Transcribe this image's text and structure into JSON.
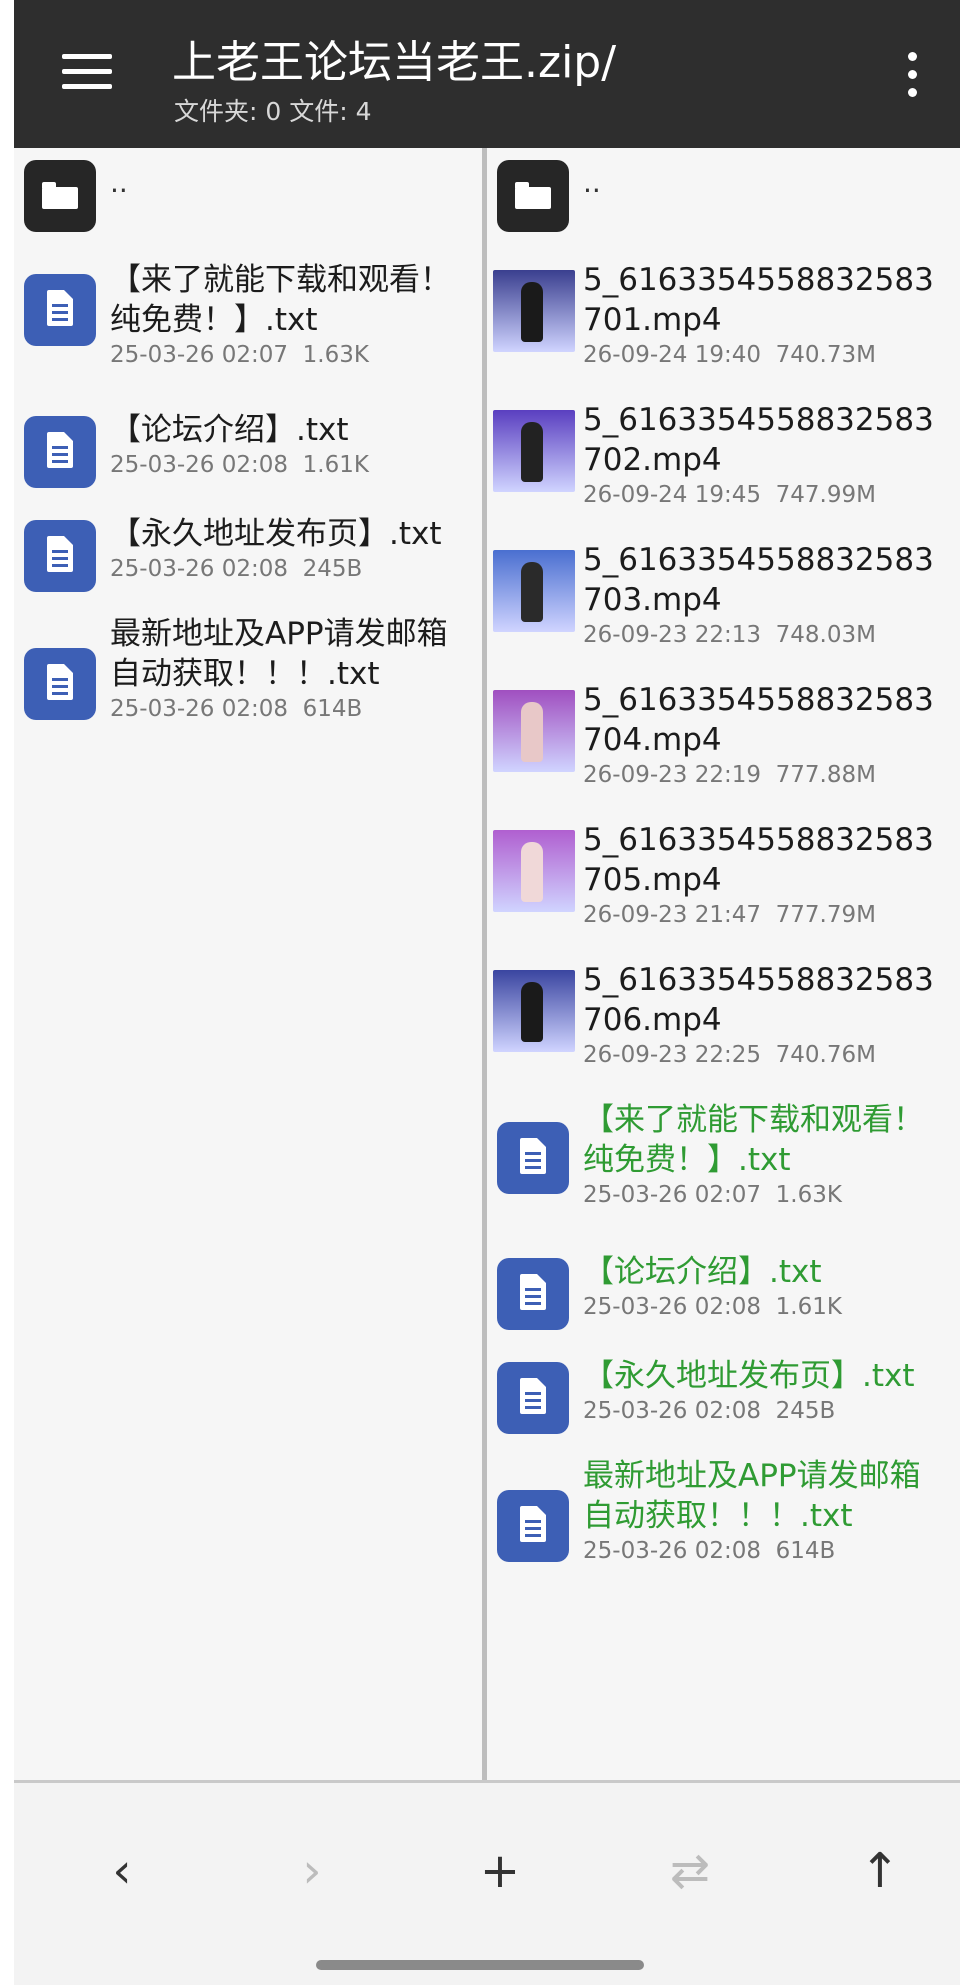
{
  "header": {
    "title": "上老王论坛当老王.zip/",
    "subtitle": "文件夹: 0  文件: 4"
  },
  "left_pane": {
    "parent_label": "..",
    "files": [
      {
        "name_line1": "【来了就能下载和观看！",
        "name_line2": "纯免费！】.txt",
        "date": "25-03-26 02:07",
        "size": "1.63K",
        "icon": "document-icon"
      },
      {
        "name_line1": "【论坛介绍】.txt",
        "name_line2": "",
        "date": "25-03-26 02:08",
        "size": "1.61K",
        "icon": "document-icon"
      },
      {
        "name_line1": "【永久地址发布页】.txt",
        "name_line2": "",
        "date": "25-03-26 02:08",
        "size": "245B",
        "icon": "document-icon"
      },
      {
        "name_line1": "最新地址及APP请发邮箱",
        "name_line2": "自动获取！！！.txt",
        "date": "25-03-26 02:08",
        "size": "614B",
        "icon": "document-icon"
      }
    ]
  },
  "right_pane": {
    "parent_label": "..",
    "videos": [
      {
        "name_line1": "5_6163354558832583",
        "name_line2": "701.mp4",
        "date": "26-09-24 19:40",
        "size": "740.73M",
        "thumb_bg": "#3a3f8f",
        "thumb_fig": "#1a1a1a"
      },
      {
        "name_line1": "5_6163354558832583",
        "name_line2": "702.mp4",
        "date": "26-09-24 19:45",
        "size": "747.99M",
        "thumb_bg": "#5a3fc0",
        "thumb_fig": "#222"
      },
      {
        "name_line1": "5_6163354558832583",
        "name_line2": "703.mp4",
        "date": "26-09-23 22:13",
        "size": "748.03M",
        "thumb_bg": "#4a6fd0",
        "thumb_fig": "#2a2a2a"
      },
      {
        "name_line1": "5_6163354558832583",
        "name_line2": "704.mp4",
        "date": "26-09-23 22:19",
        "size": "777.88M",
        "thumb_bg": "#a04fc0",
        "thumb_fig": "#e8c8c8"
      },
      {
        "name_line1": "5_6163354558832583",
        "name_line2": "705.mp4",
        "date": "26-09-23 21:47",
        "size": "777.79M",
        "thumb_bg": "#b05fd0",
        "thumb_fig": "#f0d8d8"
      },
      {
        "name_line1": "5_6163354558832583",
        "name_line2": "706.mp4",
        "date": "26-09-23 22:25",
        "size": "740.76M",
        "thumb_bg": "#3a45a0",
        "thumb_fig": "#1a1a1a"
      }
    ],
    "files": [
      {
        "name_line1": "【来了就能下载和观看！",
        "name_line2": "纯免费！】.txt",
        "date": "25-03-26 02:07",
        "size": "1.63K"
      },
      {
        "name_line1": "【论坛介绍】.txt",
        "name_line2": "",
        "date": "25-03-26 02:08",
        "size": "1.61K"
      },
      {
        "name_line1": "【永久地址发布页】.txt",
        "name_line2": "",
        "date": "25-03-26 02:08",
        "size": "245B"
      },
      {
        "name_line1": "最新地址及APP请发邮箱",
        "name_line2": "自动获取！！！.txt",
        "date": "25-03-26 02:08",
        "size": "614B"
      }
    ],
    "highlight_color": "#2f9b33"
  },
  "toolbar": {
    "back": "‹",
    "forward": "›",
    "add": "+",
    "swap": "⇄",
    "up": "↑"
  },
  "colors": {
    "appbar": "#2e2e2e",
    "doc_icon": "#3d5fb5"
  }
}
